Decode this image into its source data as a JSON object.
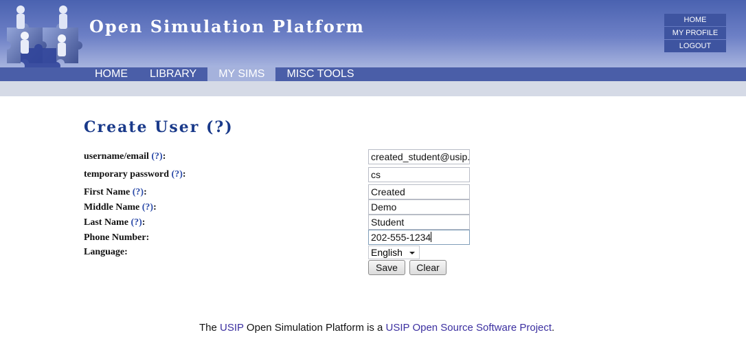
{
  "header": {
    "title": "Open Simulation Platform",
    "nav": [
      {
        "label": "HOME",
        "active": false
      },
      {
        "label": "LIBRARY",
        "active": false
      },
      {
        "label": "MY SIMS",
        "active": true
      },
      {
        "label": "MISC TOOLS",
        "active": false
      }
    ],
    "util": [
      "HOME",
      "MY PROFILE",
      "LOGOUT"
    ]
  },
  "form": {
    "title": "Create User (?)",
    "help": "(?)",
    "fields": [
      {
        "label": "username/email",
        "value": "created_student@usip.org"
      },
      {
        "label": "temporary password",
        "value": "cs"
      },
      {
        "label": "First Name",
        "value": "Created"
      },
      {
        "label": "Middle Name",
        "value": "Demo"
      },
      {
        "label": "Last Name",
        "value": "Student"
      },
      {
        "label": "Phone Number",
        "value": "202-555-1234"
      },
      {
        "label": "Language",
        "value": "English"
      }
    ],
    "save": "Save",
    "clear": "Clear"
  },
  "footer": {
    "prefix": "The ",
    "link1": "USIP",
    "middle": " Open Simulation Platform is a ",
    "link2": "USIP Open Source Software Project",
    "suffix": "."
  },
  "colors": {
    "header_top": "#4a62b0",
    "nav_bar": "#4a5ea8",
    "nav_active": "#a5b2dc",
    "title_blue": "#1a3a8a",
    "help_blue": "#2b4aa8",
    "subbar": "#d5dae6"
  }
}
